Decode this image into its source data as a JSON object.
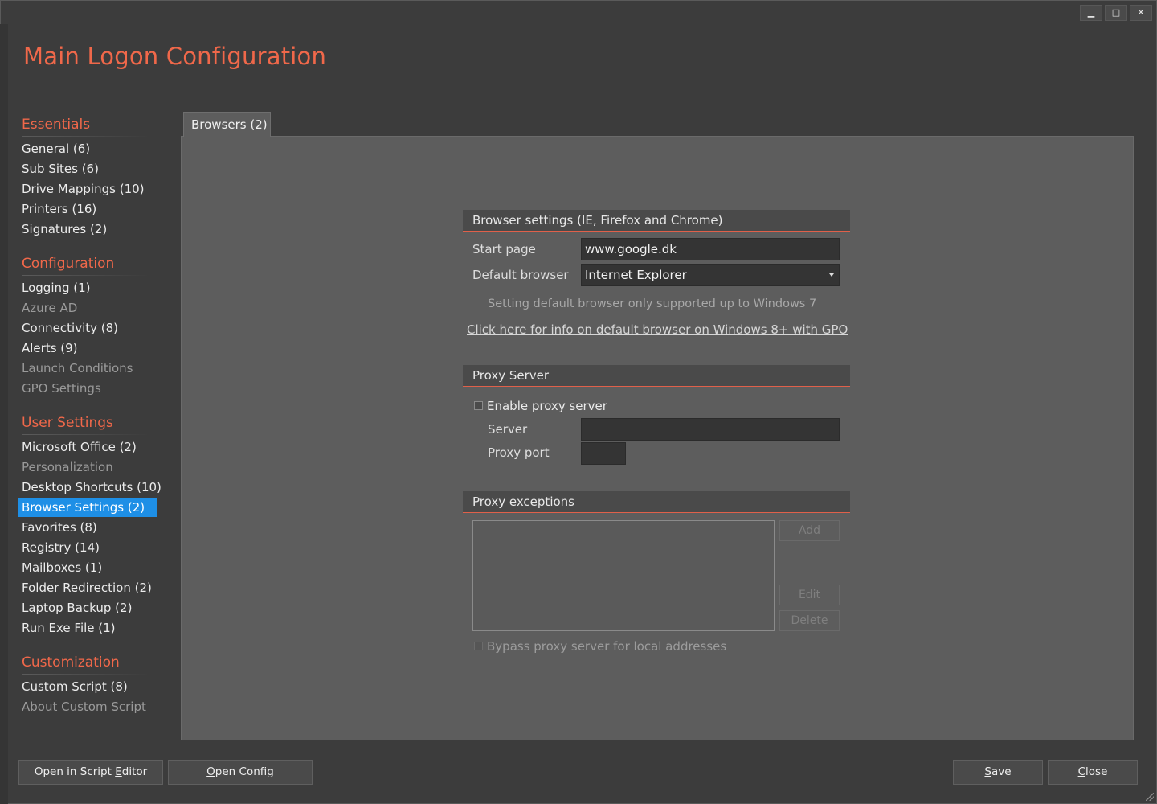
{
  "window": {
    "title": "Main Logon Configuration",
    "controls": {
      "minimize": "▁",
      "maximize": "□",
      "close": "✕"
    }
  },
  "sidebar": {
    "sections": [
      {
        "title": "Essentials",
        "items": [
          {
            "label": "General (6)",
            "enabled": true
          },
          {
            "label": "Sub Sites (6)",
            "enabled": true
          },
          {
            "label": "Drive Mappings (10)",
            "enabled": true
          },
          {
            "label": "Printers (16)",
            "enabled": true
          },
          {
            "label": "Signatures (2)",
            "enabled": true
          }
        ]
      },
      {
        "title": "Configuration",
        "items": [
          {
            "label": "Logging (1)",
            "enabled": true
          },
          {
            "label": "Azure AD",
            "enabled": false
          },
          {
            "label": "Connectivity (8)",
            "enabled": true
          },
          {
            "label": "Alerts (9)",
            "enabled": true
          },
          {
            "label": "Launch Conditions",
            "enabled": false
          },
          {
            "label": "GPO Settings",
            "enabled": false
          }
        ]
      },
      {
        "title": "User Settings",
        "items": [
          {
            "label": "Microsoft Office (2)",
            "enabled": true
          },
          {
            "label": "Personalization",
            "enabled": false
          },
          {
            "label": "Desktop Shortcuts (10)",
            "enabled": true
          },
          {
            "label": "Browser Settings (2)",
            "enabled": true,
            "selected": true
          },
          {
            "label": "Favorites (8)",
            "enabled": true
          },
          {
            "label": "Registry (14)",
            "enabled": true
          },
          {
            "label": "Mailboxes (1)",
            "enabled": true
          },
          {
            "label": "Folder Redirection (2)",
            "enabled": true
          },
          {
            "label": "Laptop Backup (2)",
            "enabled": true
          },
          {
            "label": "Run Exe File (1)",
            "enabled": true
          }
        ]
      },
      {
        "title": "Customization",
        "items": [
          {
            "label": "Custom Script (8)",
            "enabled": true
          },
          {
            "label": "About Custom Script",
            "enabled": false
          }
        ]
      }
    ]
  },
  "tabs": [
    {
      "label": "Browsers (2)",
      "active": true
    }
  ],
  "browser_settings": {
    "header": "Browser settings (IE, Firefox and Chrome)",
    "start_page_label": "Start page",
    "start_page_value": "www.google.dk",
    "default_browser_label": "Default browser",
    "default_browser_value": "Internet Explorer",
    "note": "Setting default browser only supported up to Windows 7",
    "link": "Click here for info on default browser on Windows 8+ with GPO"
  },
  "proxy_server": {
    "header": "Proxy Server",
    "enable_label": "Enable proxy server",
    "enabled": false,
    "server_label": "Server",
    "server_value": "",
    "port_label": "Proxy port",
    "port_value": ""
  },
  "proxy_exceptions": {
    "header": "Proxy exceptions",
    "items": [],
    "add_label": "Add",
    "edit_label": "Edit",
    "delete_label": "Delete",
    "bypass_label": "Bypass proxy server for local addresses",
    "bypass_checked": false
  },
  "footer": {
    "open_script_editor": {
      "pre": "Open in Script ",
      "key": "E",
      "post": "ditor"
    },
    "open_config": {
      "pre": "",
      "key": "O",
      "post": "pen Config"
    },
    "save": {
      "pre": "",
      "key": "S",
      "post": "ave"
    },
    "close": {
      "pre": "",
      "key": "C",
      "post": "lose"
    }
  },
  "colors": {
    "accent": "#f0684a",
    "selection": "#1e8fe6",
    "background": "#3c3c3c",
    "panel": "#5d5d5d"
  }
}
